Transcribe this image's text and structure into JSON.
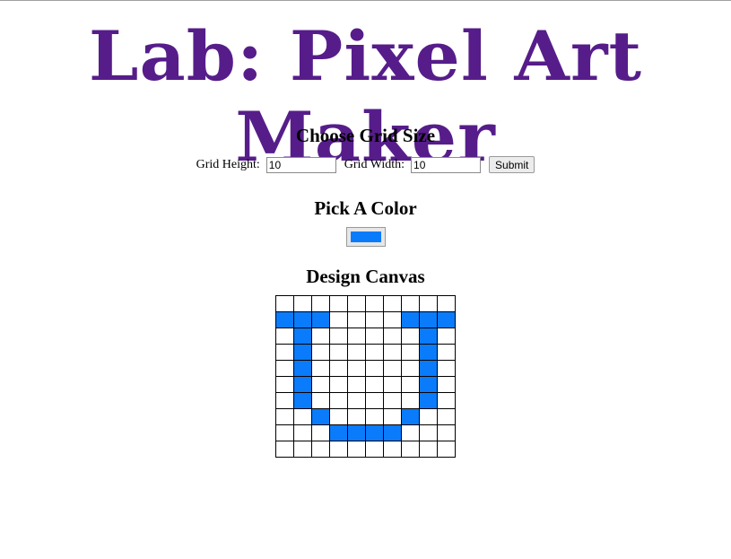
{
  "title": "Lab: Pixel Art Maker",
  "grid_size": {
    "heading": "Choose Grid Size",
    "height_label": "Grid Height:",
    "height_value": "10",
    "width_label": "Grid Width:",
    "width_value": "10",
    "submit_label": "Submit"
  },
  "color_picker": {
    "heading": "Pick A Color",
    "value": "#0a7bfb"
  },
  "canvas": {
    "heading": "Design Canvas",
    "rows": 10,
    "cols": 10,
    "fill_color": "#0a7bfb",
    "filled_cells": [
      [
        1,
        0
      ],
      [
        1,
        1
      ],
      [
        1,
        2
      ],
      [
        1,
        7
      ],
      [
        1,
        8
      ],
      [
        1,
        9
      ],
      [
        2,
        1
      ],
      [
        2,
        8
      ],
      [
        3,
        1
      ],
      [
        3,
        8
      ],
      [
        4,
        1
      ],
      [
        4,
        8
      ],
      [
        5,
        1
      ],
      [
        5,
        8
      ],
      [
        6,
        1
      ],
      [
        6,
        8
      ],
      [
        7,
        2
      ],
      [
        7,
        7
      ],
      [
        8,
        3
      ],
      [
        8,
        4
      ],
      [
        8,
        5
      ],
      [
        8,
        6
      ]
    ]
  }
}
